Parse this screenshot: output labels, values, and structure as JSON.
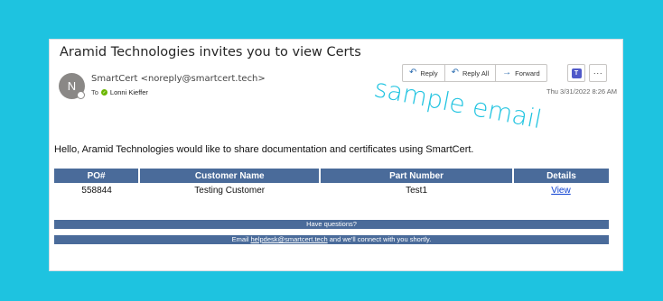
{
  "email": {
    "subject": "Aramid Technologies  invites you to view Certs",
    "avatar_initial": "N",
    "sender": "SmartCert <noreply@smartcert.tech>",
    "to_label": "To",
    "to_name": "Lonni Kieffer",
    "date": "Thu 3/31/2022 8:26 AM",
    "watermark": "sample email"
  },
  "toolbar": {
    "reply_label": "Reply",
    "reply_all_label": "Reply All",
    "forward_label": "Forward",
    "more_label": "···",
    "teams_label": "T"
  },
  "body": {
    "greeting": "Hello, Aramid Technologies would like to share documentation and certificates using SmartCert.",
    "table": {
      "headers": [
        "PO#",
        "Customer Name",
        "Part Number",
        "Details"
      ],
      "rows": [
        {
          "po": "558844",
          "customer": "Testing Customer",
          "part": "Test1",
          "details_link": "View"
        }
      ]
    },
    "questions_bar": "Have questions?",
    "contact": {
      "prefix": "Email ",
      "email": "helpdesk@smartcert.tech",
      "suffix": " and we'll connect with you shortly."
    }
  },
  "colors": {
    "background": "#1ec3e0",
    "table_header": "#4a6b9a",
    "link": "#0b3fd1"
  }
}
